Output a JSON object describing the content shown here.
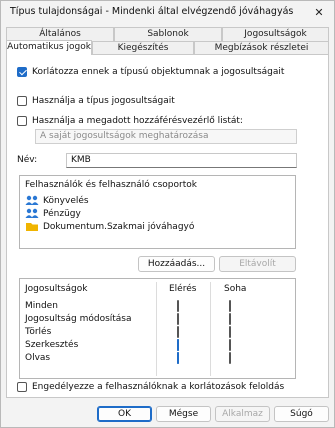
{
  "window": {
    "title": "Típus tulajdonságai - Mindenki által elvégzendő jóváhagyás",
    "close_glyph": "✕"
  },
  "tabs": {
    "row1": [
      "Általános",
      "Sablonok",
      "Jogosultságok"
    ],
    "row2": [
      "Automatikus jogok",
      "Kiegészítés",
      "Megbízások részletei"
    ],
    "active": "Automatikus jogok"
  },
  "options": {
    "restrict_label": "Korlátozza ennek a típusú objektumnak a jogosultságait",
    "restrict_checked": true,
    "use_type_label": "Használja a típus jogosultságait",
    "use_type_checked": false,
    "use_acl_label": "Használja a megadott hozzáférésvezérlő listát:",
    "use_acl_checked": false,
    "acl_dropdown_value": "A saját jogosultságok meghatározása"
  },
  "name": {
    "label": "Név:",
    "value": "KMB"
  },
  "users": {
    "header": "Felhasználók és felhasználó csoportok",
    "items": [
      {
        "label": "Könyvelés",
        "icon": "user-group-icon"
      },
      {
        "label": "Pénzügy",
        "icon": "user-group-icon"
      },
      {
        "label": "Dokumentum.Szakmai jóváhagyó",
        "icon": "pseudo-user-icon"
      }
    ],
    "add_button": "Hozzáadás...",
    "remove_button": "Eltávolít"
  },
  "permissions": {
    "col_name": "Jogosultságok",
    "col_allow": "Elérés",
    "col_deny": "Soha",
    "rows": [
      {
        "label": "Minden",
        "allow": false,
        "deny": false
      },
      {
        "label": "Jogosultság módosítása",
        "allow": false,
        "deny": false
      },
      {
        "label": "Törlés",
        "allow": false,
        "deny": false
      },
      {
        "label": "Szerkesztés",
        "allow": true,
        "deny": false
      },
      {
        "label": "Olvas",
        "allow": true,
        "deny": false
      }
    ]
  },
  "footer_option": {
    "label": "Engedélyezze a felhasználóknak a korlátozások feloldás",
    "checked": false
  },
  "buttons": {
    "ok": "OK",
    "cancel": "Mégse",
    "apply": "Alkalmaz",
    "help": "Súgó"
  },
  "colors": {
    "accent": "#1e6cc8",
    "user_icon": "#2a78d4",
    "pseudo_user_icon": "#f0b400"
  }
}
